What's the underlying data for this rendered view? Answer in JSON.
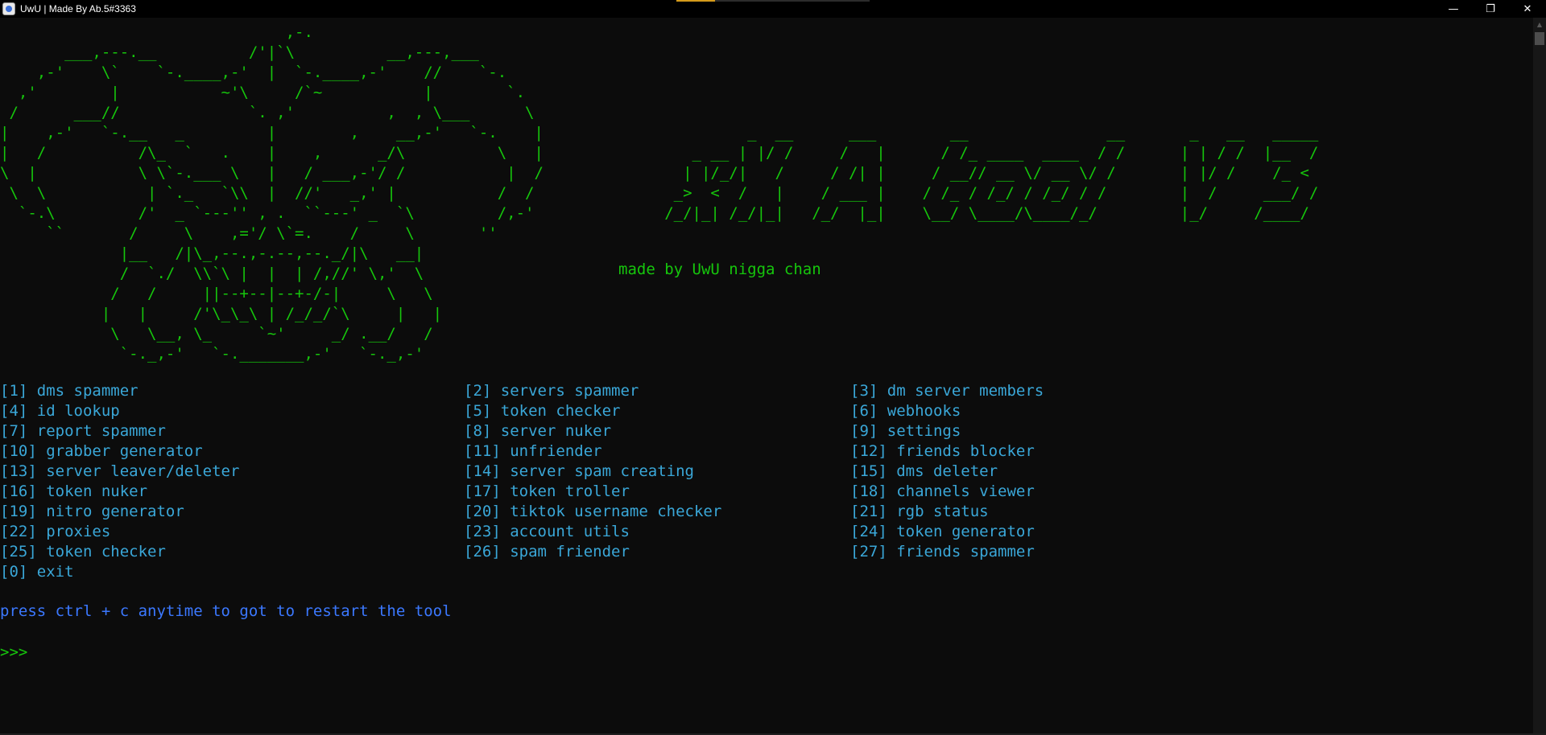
{
  "window": {
    "title": "UwU | Made By Ab.5#3363",
    "controls": {
      "minimize": "—",
      "restore": "❐",
      "close": "✕"
    }
  },
  "colors": {
    "background": "#0c0c0c",
    "ascii_green": "#16c60c",
    "menu_cyan": "#3aa7d8",
    "hint_blue": "#3b78ff"
  },
  "logo_art": "                               ,-.\n       ___,---.__          /'|`\\          __,---,___\n    ,-'    \\`    `-.____,-'  |  `-.____,-'    //    `-.\n  ,'        |           ~'\\     /`~           |        `.\n /      ___//              `. ,'          ,  , \\___      \\\n|    ,-'   `-.__   _         |        ,    __,-'   `-.    |\n|   /          /\\_  `   .    |    ,      _/\\          \\   |\n\\  |           \\ \\`-.___ \\   |   / ___,-'/ /           |  /\n \\  \\           | `._   `\\\\  |  //'   _,' |           /  /\n  `-.\\         /'  _ `---'' , .  ``---' _  `\\         /,-'\n     ``       /     \\    ,='/ \\`=.    /     \\       ''\n             |__   /|\\_,--.,-.--,--._/|\\   __|\n             /  `./  \\\\`\\ |  |  | /,//' \\,'  \\\n            /   /     ||--+--|--+-/-|     \\   \\\n           |   |     /'\\_\\_\\ | /_/_/`\\     |   |\n            \\   \\__, \\_     `~'     _/ .__/   /\n             `-._,-'   `-._______,-'   `-._,-'",
  "banner_art": "              _  __      ___        __               __       _   __   _____\n        _ __ | |/ /     /   |      / /_ ____  ____  / /      | | / /  |__  /\n       | |/_/|   /     / /| |     / __// __ \\/ __ \\/ /       | |/ /    /_ <\n      _>  <  /   |    / ___ |    / /_ / /_/ / /_/ / /        |  /     ___/ /\n     /_/|_| /_/|_|   /_/  |_|    \\__/ \\____/\\____/_/         |_/     /____/",
  "credit": "made by UwU nigga chan",
  "menu": {
    "rows": [
      [
        "[1] dms spammer",
        "[2] servers spammer",
        "[3] dm server members"
      ],
      [
        "[4] id lookup",
        "[5] token checker",
        "[6] webhooks"
      ],
      [
        "[7] report spammer",
        "[8] server nuker",
        "[9] settings"
      ],
      [
        "[10] grabber generator",
        "[11] unfriender",
        "[12] friends blocker"
      ],
      [
        "[13] server leaver/deleter",
        "[14] server spam creating",
        "[15] dms deleter"
      ],
      [
        "[16] token nuker",
        "[17] token troller",
        "[18] channels viewer"
      ],
      [
        "[19] nitro generator",
        "[20] tiktok username checker",
        "[21] rgb status"
      ],
      [
        "[22] proxies",
        "[23] account utils",
        "[24] token generator"
      ],
      [
        "[25] token checker",
        "[26] spam friender",
        "[27] friends spammer"
      ],
      [
        "[0] exit"
      ]
    ]
  },
  "hint": "press ctrl + c anytime to got to restart the tool",
  "prompt": ">>>"
}
